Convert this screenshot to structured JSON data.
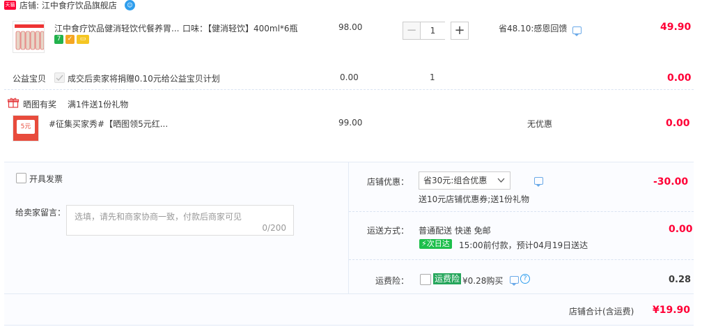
{
  "header": {
    "badge": "天猫",
    "store_label": "店铺: 江中食疗饮品旗舰店",
    "ww_icon": "ww-chat-icon"
  },
  "product": {
    "title": "江中食疗饮品健消轻饮代餐养胃...",
    "sku": "口味：【健消轻饮】400ml*6瓶",
    "price": "98.00",
    "quantity": "1",
    "promo": "省48.10:感恩回馈",
    "subtotal": "49.90",
    "service_icons": [
      "7-day-return-icon",
      "guarantee-icon",
      "card-icon"
    ]
  },
  "charity": {
    "label": "公益宝贝",
    "desc": "成交后卖家将捐赠0.10元给公益宝贝计划",
    "price": "0.00",
    "quantity": "1",
    "subtotal": "0.00"
  },
  "gift": {
    "label": "晒图有奖",
    "rule": "满1件送1份礼物",
    "title": "#征集买家秀#【晒图领5元红...",
    "price": "99.00",
    "promo": "无优惠",
    "subtotal": "0.00",
    "thumb_text": "5元"
  },
  "invoice": {
    "label": "开具发票"
  },
  "message": {
    "label": "给卖家留言：",
    "placeholder": "选填，请先和商家协商一致，付款后商家可见",
    "counter": "0/200"
  },
  "store_discount": {
    "label": "店铺优惠：",
    "selected": "省30元:组合优惠",
    "desc": "送10元店铺优惠券;送1份礼物",
    "amount": "-30.00"
  },
  "shipping": {
    "label": "运送方式：",
    "method": "普通配送 快递 免邮",
    "tag": "次日达",
    "eta": "15:00前付款，预计04月19日送达",
    "amount": "0.00"
  },
  "insurance": {
    "label": "运费险：",
    "tag": "运费险",
    "desc": "¥0.28购买",
    "amount": "0.28"
  },
  "total": {
    "label": "店铺合计(含运费)",
    "amount": "¥19.90"
  },
  "colors": {
    "accent": "#ff0036",
    "link": "#2f9eed",
    "panel": "#fbfcff",
    "green": "#1dbf4b"
  }
}
